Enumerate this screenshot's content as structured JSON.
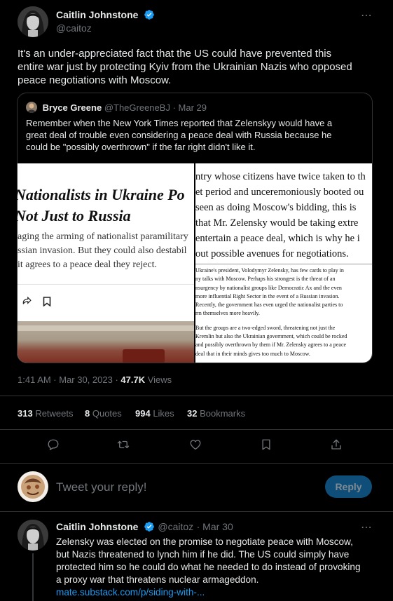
{
  "tweet": {
    "author_name": "Caitlin Johnstone",
    "author_handle": "@caitoz",
    "more_icon": "⋯",
    "text_lines": [
      "It's an under-appreciated fact that the US could have prevented this",
      "entire war just by protecting Kyiv from the Ukrainian Nazis who opposed",
      "peace negotiations with Moscow."
    ],
    "timestamp": "1:41 AM · Mar 30, 2023 · ",
    "views_count": "47.7K",
    "views_label": " Views"
  },
  "quote": {
    "author_name": "Bryce Greene",
    "author_handle": "@TheGreeneBJ",
    "date": "· Mar 29",
    "text_lines": [
      "Remember when the New York Times reported that Zelenskyy would have a",
      "great deal of trouble even considering a peace deal with Russia because he",
      "could be \"possibly overthrown\" if the far right didn't like it."
    ],
    "media_left": {
      "headline_1": "Nationalists in Ukraine Po",
      "headline_2": "Not Just to Russia",
      "body_1": "aging the arming of nationalist paramilitary",
      "body_2": "ssian invasion. But they could also destabil",
      "body_3": "it agrees to a peace deal they reject."
    },
    "media_right": {
      "lines": [
        "ntry whose citizens have twice taken to th",
        "et period and unceremoniously booted ou",
        " seen as doing Moscow's bidding, this is",
        "that Mr. Zelensky would be taking extre",
        "entertain a peace deal, which is why he i",
        "out possible avenues for negotiations."
      ],
      "small_lines": [
        "Ukraine's president, Volodymyr Zelensky, has few cards to play in",
        "ny talks with Moscow. Perhaps his strongest is the threat of an",
        "nsurgency by nationalist groups like Democratic Ax and the even",
        "more influential Right Sector in the event of a Russian invasion.",
        "Recently, the government has even urged the nationalist parties to",
        "rm themselves more heavily.",
        "",
        "But the groups are a two-edged sword, threatening not just the",
        "Kremlin but also the Ukrainian government, which could be rocked",
        "and possibly overthrown by them if Mr. Zelensky agrees to a peace",
        "deal that in their minds gives too much to Moscow."
      ]
    }
  },
  "stats": {
    "retweets_count": "313",
    "retweets_label": " Retweets",
    "quotes_count": "8",
    "quotes_label": " Quotes",
    "likes_count": "994",
    "likes_label": " Likes",
    "bookmarks_count": "32",
    "bookmarks_label": " Bookmarks"
  },
  "actions": [
    "reply-icon",
    "retweet-icon",
    "like-icon",
    "bookmark-icon",
    "share-icon"
  ],
  "composer": {
    "placeholder": "Tweet your reply!",
    "reply_button": "Reply"
  },
  "reply": {
    "author_name": "Caitlin Johnstone",
    "author_handle": "@caitoz",
    "date": "· Mar 30",
    "more_icon": "⋯",
    "text_lines": [
      "Zelensky was elected on the promise to negotiate peace with Moscow,",
      "but Nazis threatened to lynch him if he did. The US could simply have",
      "protected him so he could do what he needed to do instead of provoking",
      "a proxy war that threatens nuclear armageddon."
    ],
    "link": "mate.substack.com/p/siding-with-..."
  },
  "colors": {
    "accent": "#1d9bf0",
    "muted": "#71767b",
    "border": "#2f3336",
    "background": "#000000"
  }
}
